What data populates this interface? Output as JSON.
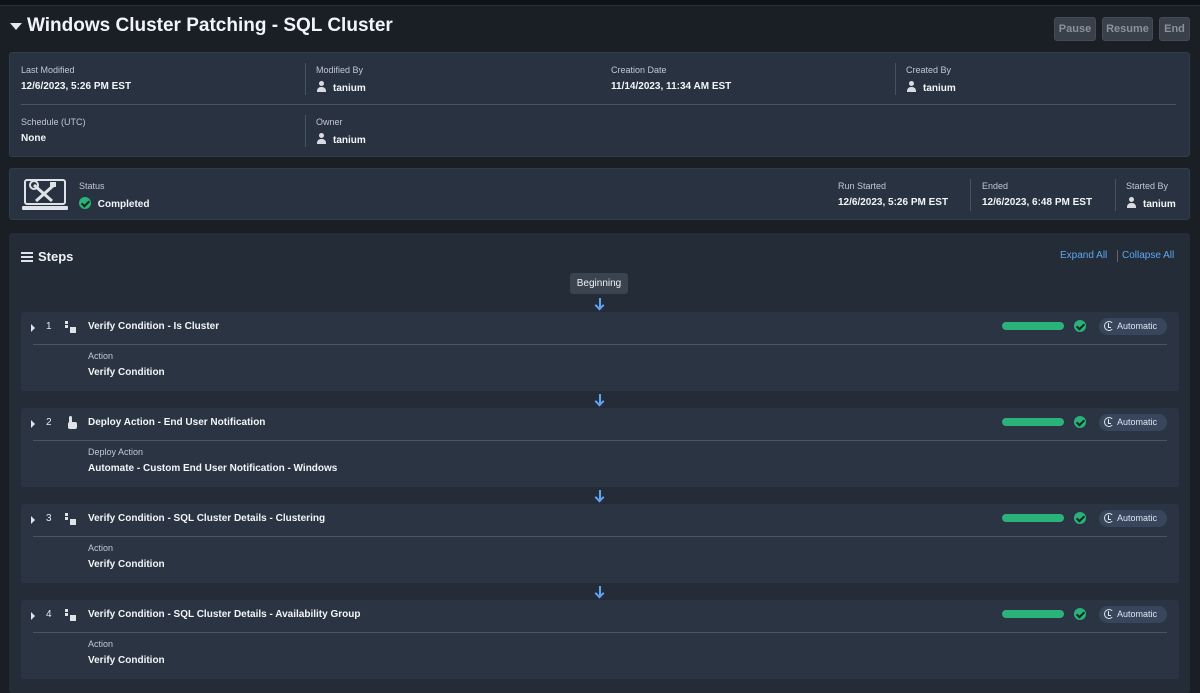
{
  "header": {
    "title": "Windows Cluster Patching - SQL Cluster",
    "buttons": {
      "pause": "Pause",
      "resume": "Resume",
      "end": "End"
    }
  },
  "details": {
    "last_modified": {
      "label": "Last Modified",
      "value": "12/6/2023, 5:26 PM EST"
    },
    "modified_by": {
      "label": "Modified By",
      "value": "tanium"
    },
    "creation_date": {
      "label": "Creation Date",
      "value": "11/14/2023, 11:34 AM EST"
    },
    "created_by": {
      "label": "Created By",
      "value": "tanium"
    },
    "schedule": {
      "label": "Schedule (UTC)",
      "value": "None"
    },
    "owner": {
      "label": "Owner",
      "value": "tanium"
    }
  },
  "run": {
    "status": {
      "label": "Status",
      "value": "Completed"
    },
    "run_started": {
      "label": "Run Started",
      "value": "12/6/2023, 5:26 PM EST"
    },
    "ended": {
      "label": "Ended",
      "value": "12/6/2023, 6:48 PM EST"
    },
    "started_by": {
      "label": "Started By",
      "value": "tanium"
    }
  },
  "steps_section": {
    "title": "Steps",
    "expand_all": "Expand All",
    "collapse_all": "Collapse All",
    "beginning": "Beginning",
    "steps": [
      {
        "number": "1",
        "icon": "condition-icon",
        "title": "Verify Condition - Is Cluster",
        "label": "Action",
        "value": "Verify Condition",
        "progress": 1.0,
        "mode": "Automatic"
      },
      {
        "number": "2",
        "icon": "hand-pointer-icon",
        "title": "Deploy Action - End User Notification",
        "label": "Deploy Action",
        "value": "Automate - Custom End User Notification - Windows",
        "progress": 1.0,
        "mode": "Automatic"
      },
      {
        "number": "3",
        "icon": "condition-icon",
        "title": "Verify Condition - SQL Cluster Details - Clustering",
        "label": "Action",
        "value": "Verify Condition",
        "progress": 1.0,
        "mode": "Automatic"
      },
      {
        "number": "4",
        "icon": "condition-icon",
        "title": "Verify Condition - SQL Cluster Details - Availability Group",
        "label": "Action",
        "value": "Verify Condition",
        "progress": 1.0,
        "mode": "Automatic"
      }
    ]
  },
  "colors": {
    "background": "#1a1e25",
    "panel": "#283241",
    "success": "#2ab27b",
    "link": "#5ea6ef"
  }
}
